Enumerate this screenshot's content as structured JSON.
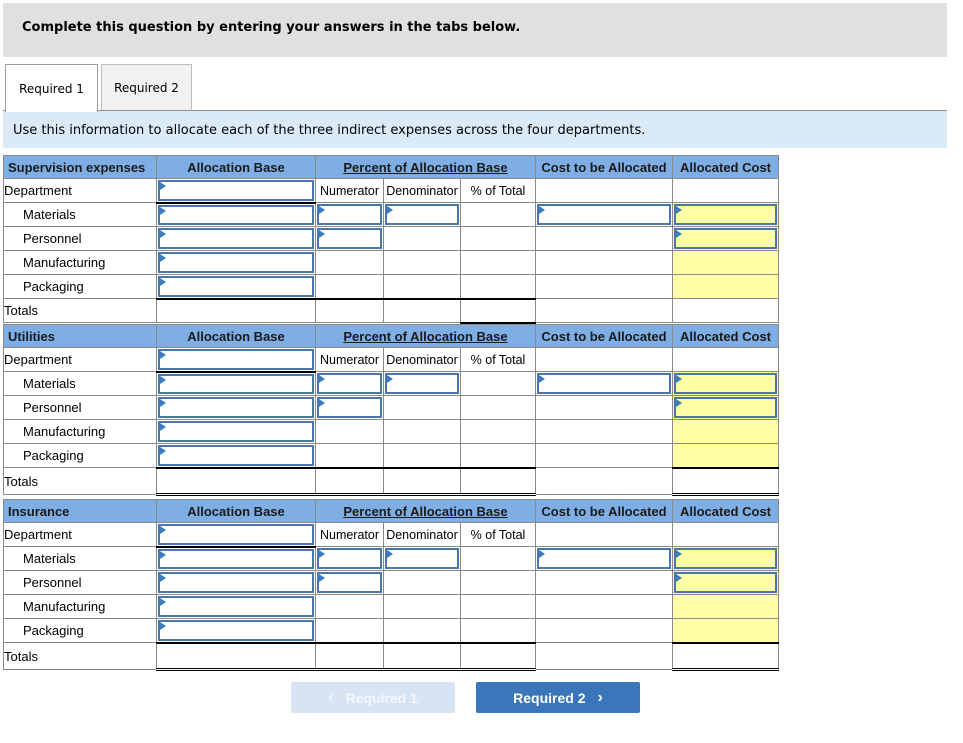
{
  "instructions": "Complete this question by entering your answers in the tabs below.",
  "tabs": [
    {
      "label": "Required 1",
      "active": true
    },
    {
      "label": "Required 2",
      "active": false
    }
  ],
  "info": "Use this information to allocate each of the three indirect expenses across the four departments.",
  "columns": {
    "allocation_base": "Allocation Base",
    "percent_of_allocation_base": "Percent of Allocation Base",
    "cost_to_be_allocated": "Cost to be Allocated",
    "allocated_cost": "Allocated Cost",
    "numerator": "Numerator",
    "denominator": "Denominator",
    "pct_total": "% of Total"
  },
  "row_labels": {
    "department": "Department",
    "totals": "Totals"
  },
  "sections": [
    {
      "title": "Supervision expenses",
      "departments": [
        "Materials",
        "Personnel",
        "Manufacturing",
        "Packaging"
      ]
    },
    {
      "title": "Utilities",
      "departments": [
        "Materials",
        "Personnel",
        "Manufacturing",
        "Packaging"
      ]
    },
    {
      "title": "Insurance",
      "departments": [
        "Materials",
        "Personnel",
        "Manufacturing",
        "Packaging"
      ]
    }
  ],
  "colors": {
    "header_blue": "#7eaee4",
    "input_border": "#4a76a8",
    "answer_yellow": "#ffffa8",
    "info_bg": "#dbeaf7"
  },
  "nav": {
    "prev_label": "Required 1",
    "prev_icon": "chevron-left-icon",
    "prev_disabled": true,
    "next_label": "Required 2",
    "next_icon": "chevron-right-icon"
  }
}
